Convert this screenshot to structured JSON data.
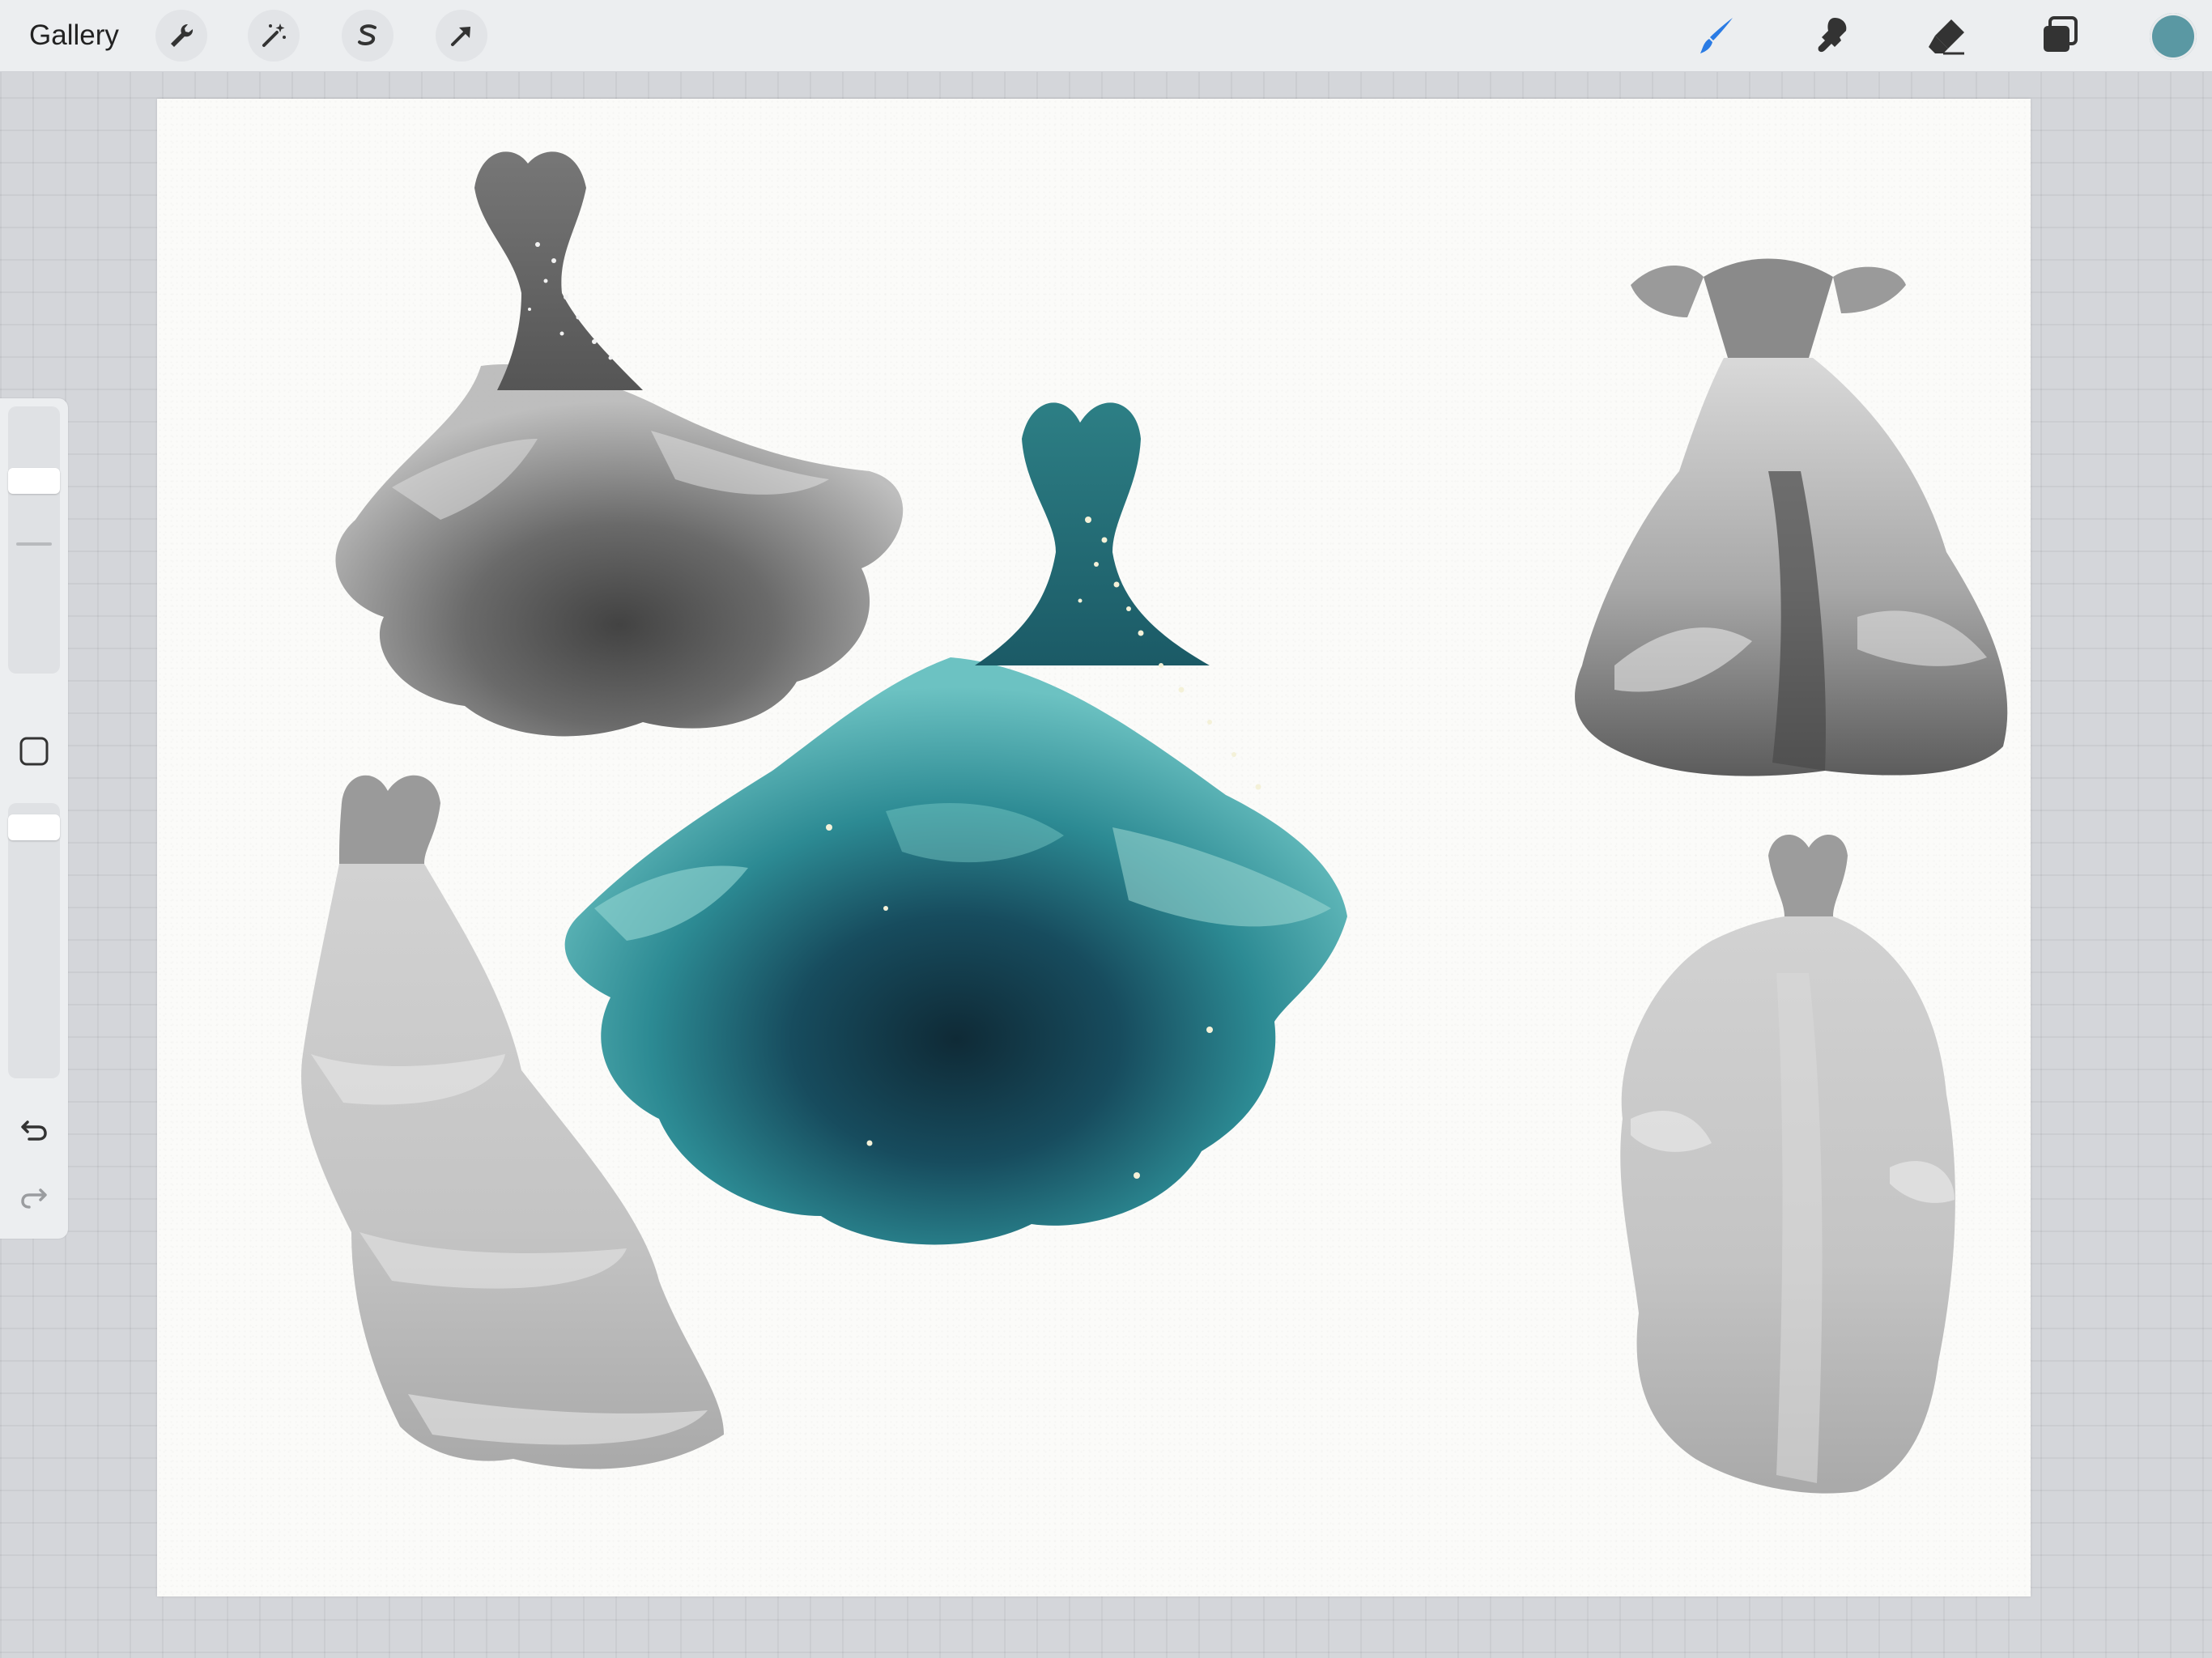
{
  "topbar": {
    "gallery_label": "Gallery",
    "left_tools": [
      "wrench-icon",
      "magic-wand-icon",
      "selection-icon",
      "transform-arrow-icon"
    ],
    "right_tools": [
      "brush-icon",
      "smudge-icon",
      "eraser-icon",
      "layers-icon"
    ],
    "active_tool": "brush-icon",
    "active_tool_color": "#2a7be4",
    "current_color": "#5a98a3"
  },
  "sidebar": {
    "controls": [
      "brush-size-slider",
      "modify-button",
      "opacity-slider",
      "undo-icon",
      "redo-icon"
    ]
  },
  "canvas": {
    "paper_color": "#fbfbf9",
    "artwork": [
      "gray-ballgown-dress",
      "teal-ballgown-dress",
      "silver-ruffled-gown",
      "gray-tiered-gown",
      "gray-ruffle-column-gown"
    ]
  }
}
